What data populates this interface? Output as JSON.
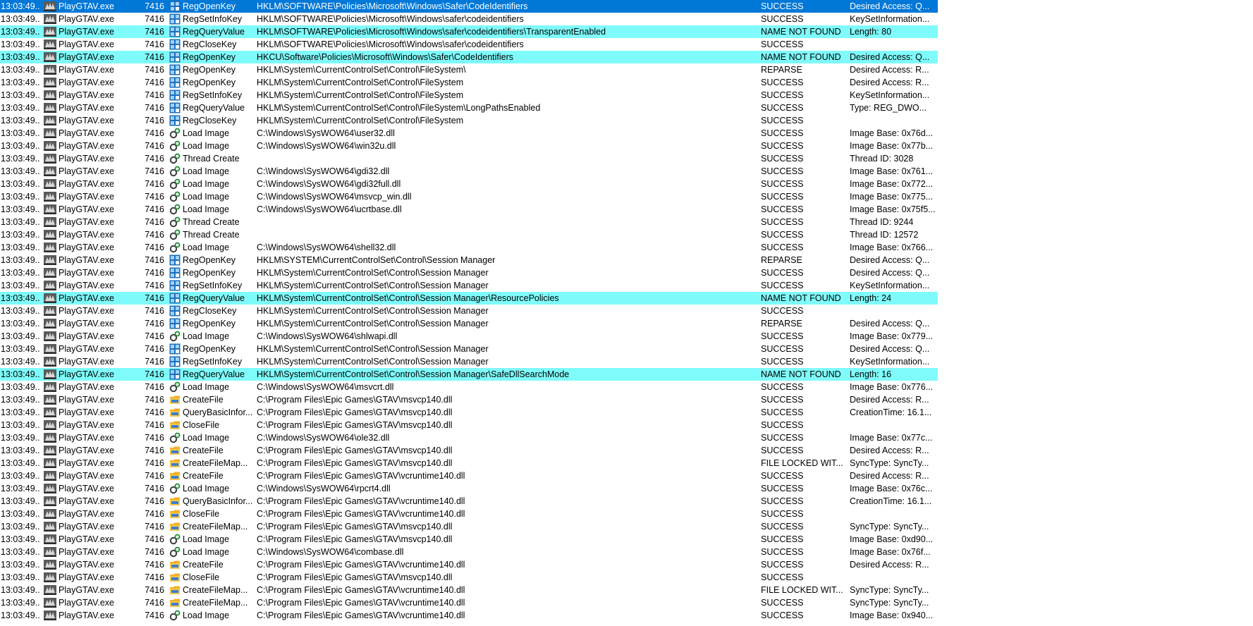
{
  "colors": {
    "selected": "#0078d7",
    "not_found": "#7ffbfb"
  },
  "icons": {
    "process": "gta-app-icon",
    "registry": "registry-icon",
    "filesystem": "folder-icon",
    "process_activity": "gear-icon"
  },
  "rows": [
    {
      "time": "13:03:49...",
      "process": "PlayGTAV.exe",
      "pid": "7416",
      "type": "reg",
      "op": "RegOpenKey",
      "path": "HKLM\\SOFTWARE\\Policies\\Microsoft\\Windows\\Safer\\CodeIdentifiers",
      "result": "SUCCESS",
      "detail": "Desired Access: Q...",
      "state": "selected"
    },
    {
      "time": "13:03:49...",
      "process": "PlayGTAV.exe",
      "pid": "7416",
      "type": "reg",
      "op": "RegSetInfoKey",
      "path": "HKLM\\SOFTWARE\\Policies\\Microsoft\\Windows\\safer\\codeidentifiers",
      "result": "SUCCESS",
      "detail": "KeySetInformation...",
      "state": ""
    },
    {
      "time": "13:03:49...",
      "process": "PlayGTAV.exe",
      "pid": "7416",
      "type": "reg",
      "op": "RegQueryValue",
      "path": "HKLM\\SOFTWARE\\Policies\\Microsoft\\Windows\\safer\\codeidentifiers\\TransparentEnabled",
      "result": "NAME NOT FOUND",
      "detail": "Length: 80",
      "state": "nf"
    },
    {
      "time": "13:03:49...",
      "process": "PlayGTAV.exe",
      "pid": "7416",
      "type": "reg",
      "op": "RegCloseKey",
      "path": "HKLM\\SOFTWARE\\Policies\\Microsoft\\Windows\\safer\\codeidentifiers",
      "result": "SUCCESS",
      "detail": "",
      "state": ""
    },
    {
      "time": "13:03:49...",
      "process": "PlayGTAV.exe",
      "pid": "7416",
      "type": "reg",
      "op": "RegOpenKey",
      "path": "HKCU\\Software\\Policies\\Microsoft\\Windows\\Safer\\CodeIdentifiers",
      "result": "NAME NOT FOUND",
      "detail": "Desired Access: Q...",
      "state": "nf"
    },
    {
      "time": "13:03:49...",
      "process": "PlayGTAV.exe",
      "pid": "7416",
      "type": "reg",
      "op": "RegOpenKey",
      "path": "HKLM\\System\\CurrentControlSet\\Control\\FileSystem\\",
      "result": "REPARSE",
      "detail": "Desired Access: R...",
      "state": ""
    },
    {
      "time": "13:03:49...",
      "process": "PlayGTAV.exe",
      "pid": "7416",
      "type": "reg",
      "op": "RegOpenKey",
      "path": "HKLM\\System\\CurrentControlSet\\Control\\FileSystem",
      "result": "SUCCESS",
      "detail": "Desired Access: R...",
      "state": ""
    },
    {
      "time": "13:03:49...",
      "process": "PlayGTAV.exe",
      "pid": "7416",
      "type": "reg",
      "op": "RegSetInfoKey",
      "path": "HKLM\\System\\CurrentControlSet\\Control\\FileSystem",
      "result": "SUCCESS",
      "detail": "KeySetInformation...",
      "state": ""
    },
    {
      "time": "13:03:49...",
      "process": "PlayGTAV.exe",
      "pid": "7416",
      "type": "reg",
      "op": "RegQueryValue",
      "path": "HKLM\\System\\CurrentControlSet\\Control\\FileSystem\\LongPathsEnabled",
      "result": "SUCCESS",
      "detail": "Type: REG_DWO...",
      "state": ""
    },
    {
      "time": "13:03:49...",
      "process": "PlayGTAV.exe",
      "pid": "7416",
      "type": "reg",
      "op": "RegCloseKey",
      "path": "HKLM\\System\\CurrentControlSet\\Control\\FileSystem",
      "result": "SUCCESS",
      "detail": "",
      "state": ""
    },
    {
      "time": "13:03:49...",
      "process": "PlayGTAV.exe",
      "pid": "7416",
      "type": "proc",
      "op": "Load Image",
      "path": "C:\\Windows\\SysWOW64\\user32.dll",
      "result": "SUCCESS",
      "detail": "Image Base: 0x76d...",
      "state": ""
    },
    {
      "time": "13:03:49...",
      "process": "PlayGTAV.exe",
      "pid": "7416",
      "type": "proc",
      "op": "Load Image",
      "path": "C:\\Windows\\SysWOW64\\win32u.dll",
      "result": "SUCCESS",
      "detail": "Image Base: 0x77b...",
      "state": ""
    },
    {
      "time": "13:03:49...",
      "process": "PlayGTAV.exe",
      "pid": "7416",
      "type": "proc",
      "op": "Thread Create",
      "path": "",
      "result": "SUCCESS",
      "detail": "Thread ID: 3028",
      "state": ""
    },
    {
      "time": "13:03:49...",
      "process": "PlayGTAV.exe",
      "pid": "7416",
      "type": "proc",
      "op": "Load Image",
      "path": "C:\\Windows\\SysWOW64\\gdi32.dll",
      "result": "SUCCESS",
      "detail": "Image Base: 0x761...",
      "state": ""
    },
    {
      "time": "13:03:49...",
      "process": "PlayGTAV.exe",
      "pid": "7416",
      "type": "proc",
      "op": "Load Image",
      "path": "C:\\Windows\\SysWOW64\\gdi32full.dll",
      "result": "SUCCESS",
      "detail": "Image Base: 0x772...",
      "state": ""
    },
    {
      "time": "13:03:49...",
      "process": "PlayGTAV.exe",
      "pid": "7416",
      "type": "proc",
      "op": "Load Image",
      "path": "C:\\Windows\\SysWOW64\\msvcp_win.dll",
      "result": "SUCCESS",
      "detail": "Image Base: 0x775...",
      "state": ""
    },
    {
      "time": "13:03:49...",
      "process": "PlayGTAV.exe",
      "pid": "7416",
      "type": "proc",
      "op": "Load Image",
      "path": "C:\\Windows\\SysWOW64\\ucrtbase.dll",
      "result": "SUCCESS",
      "detail": "Image Base: 0x75f5...",
      "state": ""
    },
    {
      "time": "13:03:49...",
      "process": "PlayGTAV.exe",
      "pid": "7416",
      "type": "proc",
      "op": "Thread Create",
      "path": "",
      "result": "SUCCESS",
      "detail": "Thread ID: 9244",
      "state": ""
    },
    {
      "time": "13:03:49...",
      "process": "PlayGTAV.exe",
      "pid": "7416",
      "type": "proc",
      "op": "Thread Create",
      "path": "",
      "result": "SUCCESS",
      "detail": "Thread ID: 12572",
      "state": ""
    },
    {
      "time": "13:03:49...",
      "process": "PlayGTAV.exe",
      "pid": "7416",
      "type": "proc",
      "op": "Load Image",
      "path": "C:\\Windows\\SysWOW64\\shell32.dll",
      "result": "SUCCESS",
      "detail": "Image Base: 0x766...",
      "state": ""
    },
    {
      "time": "13:03:49...",
      "process": "PlayGTAV.exe",
      "pid": "7416",
      "type": "reg",
      "op": "RegOpenKey",
      "path": "HKLM\\SYSTEM\\CurrentControlSet\\Control\\Session Manager",
      "result": "REPARSE",
      "detail": "Desired Access: Q...",
      "state": ""
    },
    {
      "time": "13:03:49...",
      "process": "PlayGTAV.exe",
      "pid": "7416",
      "type": "reg",
      "op": "RegOpenKey",
      "path": "HKLM\\System\\CurrentControlSet\\Control\\Session Manager",
      "result": "SUCCESS",
      "detail": "Desired Access: Q...",
      "state": ""
    },
    {
      "time": "13:03:49...",
      "process": "PlayGTAV.exe",
      "pid": "7416",
      "type": "reg",
      "op": "RegSetInfoKey",
      "path": "HKLM\\System\\CurrentControlSet\\Control\\Session Manager",
      "result": "SUCCESS",
      "detail": "KeySetInformation...",
      "state": ""
    },
    {
      "time": "13:03:49...",
      "process": "PlayGTAV.exe",
      "pid": "7416",
      "type": "reg",
      "op": "RegQueryValue",
      "path": "HKLM\\System\\CurrentControlSet\\Control\\Session Manager\\ResourcePolicies",
      "result": "NAME NOT FOUND",
      "detail": "Length: 24",
      "state": "nf"
    },
    {
      "time": "13:03:49...",
      "process": "PlayGTAV.exe",
      "pid": "7416",
      "type": "reg",
      "op": "RegCloseKey",
      "path": "HKLM\\System\\CurrentControlSet\\Control\\Session Manager",
      "result": "SUCCESS",
      "detail": "",
      "state": ""
    },
    {
      "time": "13:03:49...",
      "process": "PlayGTAV.exe",
      "pid": "7416",
      "type": "reg",
      "op": "RegOpenKey",
      "path": "HKLM\\System\\CurrentControlSet\\Control\\Session Manager",
      "result": "REPARSE",
      "detail": "Desired Access: Q...",
      "state": ""
    },
    {
      "time": "13:03:49...",
      "process": "PlayGTAV.exe",
      "pid": "7416",
      "type": "proc",
      "op": "Load Image",
      "path": "C:\\Windows\\SysWOW64\\shlwapi.dll",
      "result": "SUCCESS",
      "detail": "Image Base: 0x779...",
      "state": ""
    },
    {
      "time": "13:03:49...",
      "process": "PlayGTAV.exe",
      "pid": "7416",
      "type": "reg",
      "op": "RegOpenKey",
      "path": "HKLM\\System\\CurrentControlSet\\Control\\Session Manager",
      "result": "SUCCESS",
      "detail": "Desired Access: Q...",
      "state": ""
    },
    {
      "time": "13:03:49...",
      "process": "PlayGTAV.exe",
      "pid": "7416",
      "type": "reg",
      "op": "RegSetInfoKey",
      "path": "HKLM\\System\\CurrentControlSet\\Control\\Session Manager",
      "result": "SUCCESS",
      "detail": "KeySetInformation...",
      "state": ""
    },
    {
      "time": "13:03:49...",
      "process": "PlayGTAV.exe",
      "pid": "7416",
      "type": "reg",
      "op": "RegQueryValue",
      "path": "HKLM\\System\\CurrentControlSet\\Control\\Session Manager\\SafeDllSearchMode",
      "result": "NAME NOT FOUND",
      "detail": "Length: 16",
      "state": "nf"
    },
    {
      "time": "13:03:49...",
      "process": "PlayGTAV.exe",
      "pid": "7416",
      "type": "proc",
      "op": "Load Image",
      "path": "C:\\Windows\\SysWOW64\\msvcrt.dll",
      "result": "SUCCESS",
      "detail": "Image Base: 0x776...",
      "state": ""
    },
    {
      "time": "13:03:49...",
      "process": "PlayGTAV.exe",
      "pid": "7416",
      "type": "file",
      "op": "CreateFile",
      "path": "C:\\Program Files\\Epic Games\\GTAV\\msvcp140.dll",
      "result": "SUCCESS",
      "detail": "Desired Access: R...",
      "state": ""
    },
    {
      "time": "13:03:49...",
      "process": "PlayGTAV.exe",
      "pid": "7416",
      "type": "file",
      "op": "QueryBasicInfor...",
      "path": "C:\\Program Files\\Epic Games\\GTAV\\msvcp140.dll",
      "result": "SUCCESS",
      "detail": "CreationTime: 16.1...",
      "state": ""
    },
    {
      "time": "13:03:49...",
      "process": "PlayGTAV.exe",
      "pid": "7416",
      "type": "file",
      "op": "CloseFile",
      "path": "C:\\Program Files\\Epic Games\\GTAV\\msvcp140.dll",
      "result": "SUCCESS",
      "detail": "",
      "state": ""
    },
    {
      "time": "13:03:49...",
      "process": "PlayGTAV.exe",
      "pid": "7416",
      "type": "proc",
      "op": "Load Image",
      "path": "C:\\Windows\\SysWOW64\\ole32.dll",
      "result": "SUCCESS",
      "detail": "Image Base: 0x77c...",
      "state": ""
    },
    {
      "time": "13:03:49...",
      "process": "PlayGTAV.exe",
      "pid": "7416",
      "type": "file",
      "op": "CreateFile",
      "path": "C:\\Program Files\\Epic Games\\GTAV\\msvcp140.dll",
      "result": "SUCCESS",
      "detail": "Desired Access: R...",
      "state": ""
    },
    {
      "time": "13:03:49...",
      "process": "PlayGTAV.exe",
      "pid": "7416",
      "type": "file",
      "op": "CreateFileMap...",
      "path": "C:\\Program Files\\Epic Games\\GTAV\\msvcp140.dll",
      "result": "FILE LOCKED WIT...",
      "detail": "SyncType: SyncTy...",
      "state": ""
    },
    {
      "time": "13:03:49...",
      "process": "PlayGTAV.exe",
      "pid": "7416",
      "type": "file",
      "op": "CreateFile",
      "path": "C:\\Program Files\\Epic Games\\GTAV\\vcruntime140.dll",
      "result": "SUCCESS",
      "detail": "Desired Access: R...",
      "state": ""
    },
    {
      "time": "13:03:49...",
      "process": "PlayGTAV.exe",
      "pid": "7416",
      "type": "proc",
      "op": "Load Image",
      "path": "C:\\Windows\\SysWOW64\\rpcrt4.dll",
      "result": "SUCCESS",
      "detail": "Image Base: 0x76c...",
      "state": ""
    },
    {
      "time": "13:03:49...",
      "process": "PlayGTAV.exe",
      "pid": "7416",
      "type": "file",
      "op": "QueryBasicInfor...",
      "path": "C:\\Program Files\\Epic Games\\GTAV\\vcruntime140.dll",
      "result": "SUCCESS",
      "detail": "CreationTime: 16.1...",
      "state": ""
    },
    {
      "time": "13:03:49...",
      "process": "PlayGTAV.exe",
      "pid": "7416",
      "type": "file",
      "op": "CloseFile",
      "path": "C:\\Program Files\\Epic Games\\GTAV\\vcruntime140.dll",
      "result": "SUCCESS",
      "detail": "",
      "state": ""
    },
    {
      "time": "13:03:49...",
      "process": "PlayGTAV.exe",
      "pid": "7416",
      "type": "file",
      "op": "CreateFileMap...",
      "path": "C:\\Program Files\\Epic Games\\GTAV\\msvcp140.dll",
      "result": "SUCCESS",
      "detail": "SyncType: SyncTy...",
      "state": ""
    },
    {
      "time": "13:03:49...",
      "process": "PlayGTAV.exe",
      "pid": "7416",
      "type": "proc",
      "op": "Load Image",
      "path": "C:\\Program Files\\Epic Games\\GTAV\\msvcp140.dll",
      "result": "SUCCESS",
      "detail": "Image Base: 0xd90...",
      "state": ""
    },
    {
      "time": "13:03:49...",
      "process": "PlayGTAV.exe",
      "pid": "7416",
      "type": "proc",
      "op": "Load Image",
      "path": "C:\\Windows\\SysWOW64\\combase.dll",
      "result": "SUCCESS",
      "detail": "Image Base: 0x76f...",
      "state": ""
    },
    {
      "time": "13:03:49...",
      "process": "PlayGTAV.exe",
      "pid": "7416",
      "type": "file",
      "op": "CreateFile",
      "path": "C:\\Program Files\\Epic Games\\GTAV\\vcruntime140.dll",
      "result": "SUCCESS",
      "detail": "Desired Access: R...",
      "state": ""
    },
    {
      "time": "13:03:49...",
      "process": "PlayGTAV.exe",
      "pid": "7416",
      "type": "file",
      "op": "CloseFile",
      "path": "C:\\Program Files\\Epic Games\\GTAV\\msvcp140.dll",
      "result": "SUCCESS",
      "detail": "",
      "state": ""
    },
    {
      "time": "13:03:49...",
      "process": "PlayGTAV.exe",
      "pid": "7416",
      "type": "file",
      "op": "CreateFileMap...",
      "path": "C:\\Program Files\\Epic Games\\GTAV\\vcruntime140.dll",
      "result": "FILE LOCKED WIT...",
      "detail": "SyncType: SyncTy...",
      "state": ""
    },
    {
      "time": "13:03:49...",
      "process": "PlayGTAV.exe",
      "pid": "7416",
      "type": "file",
      "op": "CreateFileMap...",
      "path": "C:\\Program Files\\Epic Games\\GTAV\\vcruntime140.dll",
      "result": "SUCCESS",
      "detail": "SyncType: SyncTy...",
      "state": ""
    },
    {
      "time": "13:03:49...",
      "process": "PlayGTAV.exe",
      "pid": "7416",
      "type": "proc",
      "op": "Load Image",
      "path": "C:\\Program Files\\Epic Games\\GTAV\\vcruntime140.dll",
      "result": "SUCCESS",
      "detail": "Image Base: 0x940...",
      "state": ""
    }
  ]
}
